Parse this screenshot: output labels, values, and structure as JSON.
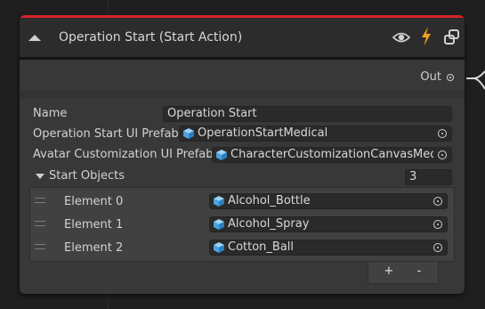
{
  "node": {
    "title": "Operation Start (Start Action)",
    "accent_color": "#d8232a",
    "header_icons": [
      "eye-icon",
      "bolt-icon",
      "link-icon"
    ],
    "out_port_label": "Out"
  },
  "properties": {
    "name_label": "Name",
    "name_value": "Operation Start",
    "ui_prefab_label": "Operation Start UI Prefab",
    "ui_prefab_value": "OperationStartMedical",
    "avatar_prefab_label": "Avatar Customization UI Prefab",
    "avatar_prefab_value": "CharacterCustomizationCanvasMedi",
    "start_objects_label": "Start Objects",
    "start_objects_count": "3"
  },
  "start_objects": [
    {
      "label": "Element 0",
      "value": "Alcohol_Bottle"
    },
    {
      "label": "Element 1",
      "value": "Alcohol_Spray"
    },
    {
      "label": "Element 2",
      "value": "Cotton_Ball"
    }
  ],
  "list_buttons": {
    "add": "+",
    "remove": "-"
  }
}
